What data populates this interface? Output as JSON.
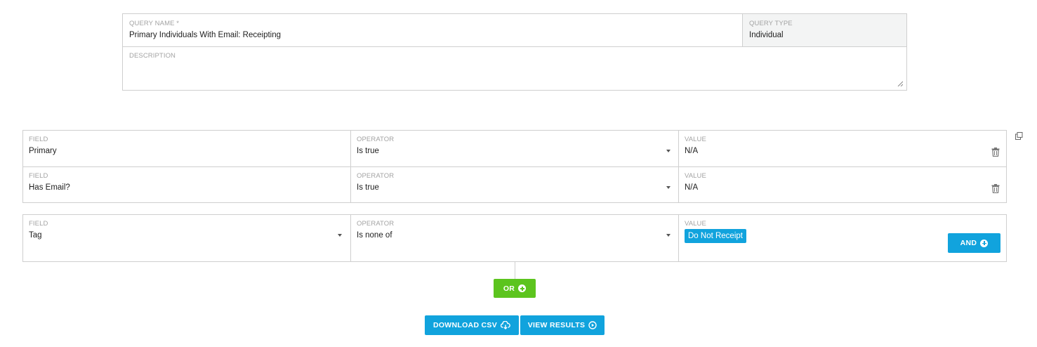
{
  "query": {
    "name_label": "QUERY NAME *",
    "name_value": "Primary Individuals With Email: Receipting",
    "type_label": "QUERY TYPE",
    "type_value": "Individual",
    "description_label": "DESCRIPTION",
    "description_value": ""
  },
  "group1": {
    "rows": [
      {
        "field_label": "FIELD",
        "field": "Primary",
        "operator_label": "OPERATOR",
        "operator": "Is true",
        "value_label": "VALUE",
        "value": "N/A"
      },
      {
        "field_label": "FIELD",
        "field": "Has Email?",
        "operator_label": "OPERATOR",
        "operator": "Is true",
        "value_label": "VALUE",
        "value": "N/A"
      }
    ]
  },
  "group2": {
    "field_label": "FIELD",
    "field": "Tag",
    "operator_label": "OPERATOR",
    "operator": "Is none of",
    "value_label": "VALUE",
    "tag": "Do Not Receipt",
    "and_label": "AND"
  },
  "buttons": {
    "or_label": "OR",
    "download_label": "DOWNLOAD CSV",
    "view_label": "VIEW RESULTS"
  },
  "icons": {
    "copy": "copy-icon",
    "trash": "trash-icon",
    "plus": "plus-circle-icon",
    "download": "cloud-download-icon",
    "play": "play-circle-icon",
    "caret": "caret-down-icon"
  },
  "colors": {
    "accent": "#11a3dd",
    "green": "#5cc41e",
    "border": "#cfcfcf"
  }
}
